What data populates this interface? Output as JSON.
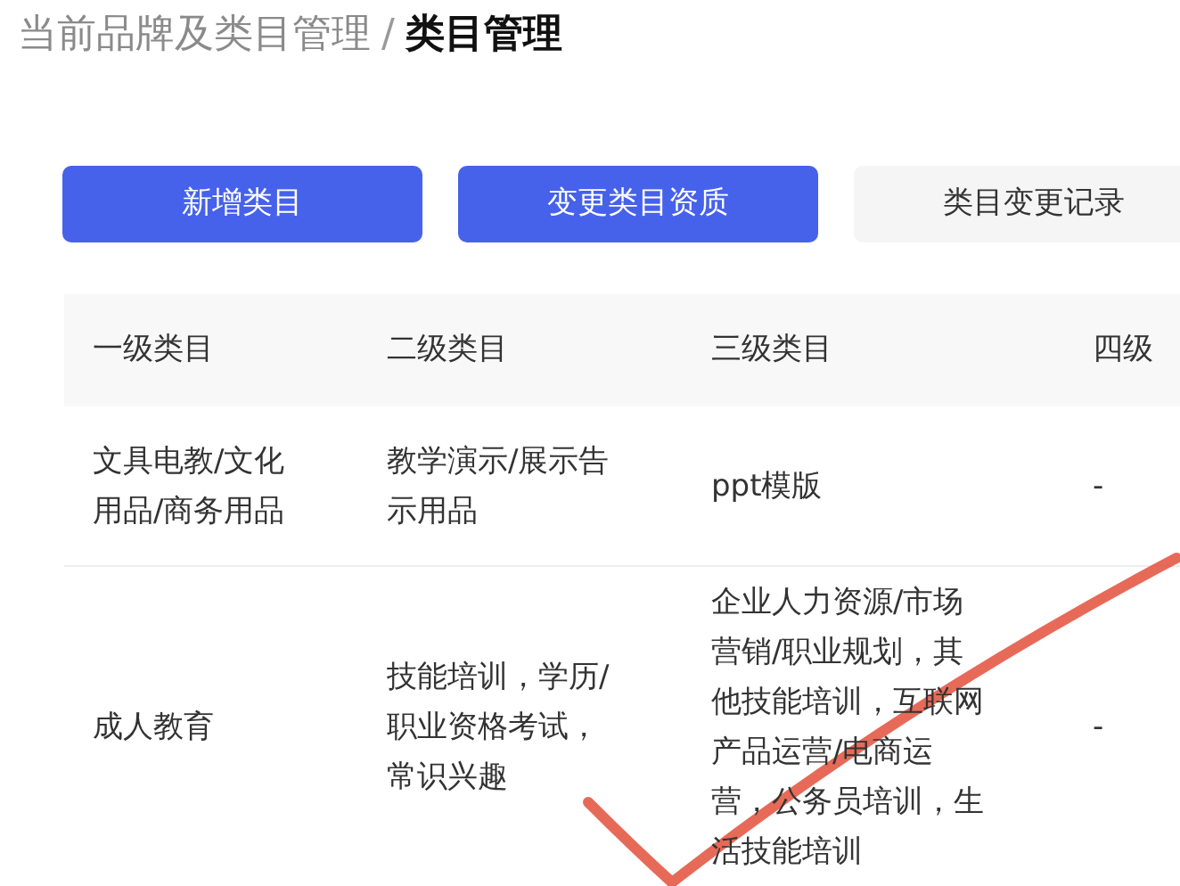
{
  "breadcrumb": [
    {
      "label": "当前品牌及类目管理",
      "current": false
    },
    {
      "label": "类目管理",
      "current": true
    }
  ],
  "breadcrumb_separator": "/",
  "buttons": [
    {
      "label": "新增类目",
      "kind": "primary"
    },
    {
      "label": "变更类目资质",
      "kind": "primary"
    },
    {
      "label": "类目变更记录",
      "kind": "secondary"
    }
  ],
  "table": {
    "columns": [
      "一级类目",
      "二级类目",
      "三级类目",
      "四级"
    ],
    "rows": [
      {
        "cells": [
          [
            "文具电教/文化",
            "用品/商务用品"
          ],
          [
            "教学演示/展示告",
            "示用品"
          ],
          [
            "ppt模版"
          ],
          [
            "-"
          ]
        ]
      },
      {
        "cells": [
          [
            "成人教育"
          ],
          [
            "技能培训，学历/",
            "职业资格考试，",
            "常识兴趣"
          ],
          [
            "企业人力资源/市场",
            "营销/职业规划，其",
            "他技能培训，互联网",
            "产品运营/电商运",
            "营，公务员培训，生",
            "活技能培训"
          ],
          [
            "-"
          ]
        ]
      }
    ]
  }
}
